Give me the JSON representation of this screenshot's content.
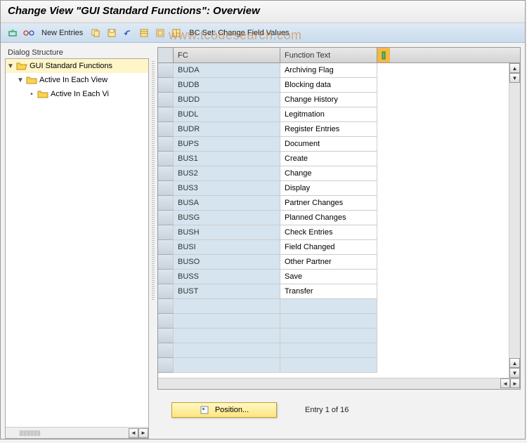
{
  "title": "Change View \"GUI Standard Functions\": Overview",
  "toolbar": {
    "new_entries": "New Entries",
    "bcset_link": "BC Set: Change Field Values"
  },
  "tree": {
    "title": "Dialog Structure",
    "items": [
      {
        "label": "GUI Standard Functions",
        "indent": 0,
        "open": true,
        "selected": true
      },
      {
        "label": "Active In Each View",
        "indent": 1,
        "open": true,
        "selected": false
      },
      {
        "label": "Active In Each Vi",
        "indent": 2,
        "open": false,
        "selected": false
      }
    ]
  },
  "grid": {
    "headers": {
      "fc": "FC",
      "ft": "Function Text"
    },
    "rows": [
      {
        "fc": "BUDA",
        "ft": "Archiving Flag"
      },
      {
        "fc": "BUDB",
        "ft": "Blocking data"
      },
      {
        "fc": "BUDD",
        "ft": "Change History"
      },
      {
        "fc": "BUDL",
        "ft": "Legitmation"
      },
      {
        "fc": "BUDR",
        "ft": "Register Entries"
      },
      {
        "fc": "BUPS",
        "ft": "Document"
      },
      {
        "fc": "BUS1",
        "ft": "Create"
      },
      {
        "fc": "BUS2",
        "ft": "Change"
      },
      {
        "fc": "BUS3",
        "ft": "Display"
      },
      {
        "fc": "BUSA",
        "ft": "Partner Changes"
      },
      {
        "fc": "BUSG",
        "ft": "Planned Changes"
      },
      {
        "fc": "BUSH",
        "ft": "Check Entries"
      },
      {
        "fc": "BUSI",
        "ft": "Field Changed"
      },
      {
        "fc": "BUSO",
        "ft": "Other Partner"
      },
      {
        "fc": "BUSS",
        "ft": "Save"
      },
      {
        "fc": "BUST",
        "ft": "Transfer"
      },
      {
        "fc": "",
        "ft": ""
      },
      {
        "fc": "",
        "ft": ""
      },
      {
        "fc": "",
        "ft": ""
      },
      {
        "fc": "",
        "ft": ""
      },
      {
        "fc": "",
        "ft": ""
      }
    ]
  },
  "footer": {
    "position_label": "Position...",
    "entry_text": "Entry 1 of 16"
  },
  "watermark": "www.tcodesearch.com"
}
